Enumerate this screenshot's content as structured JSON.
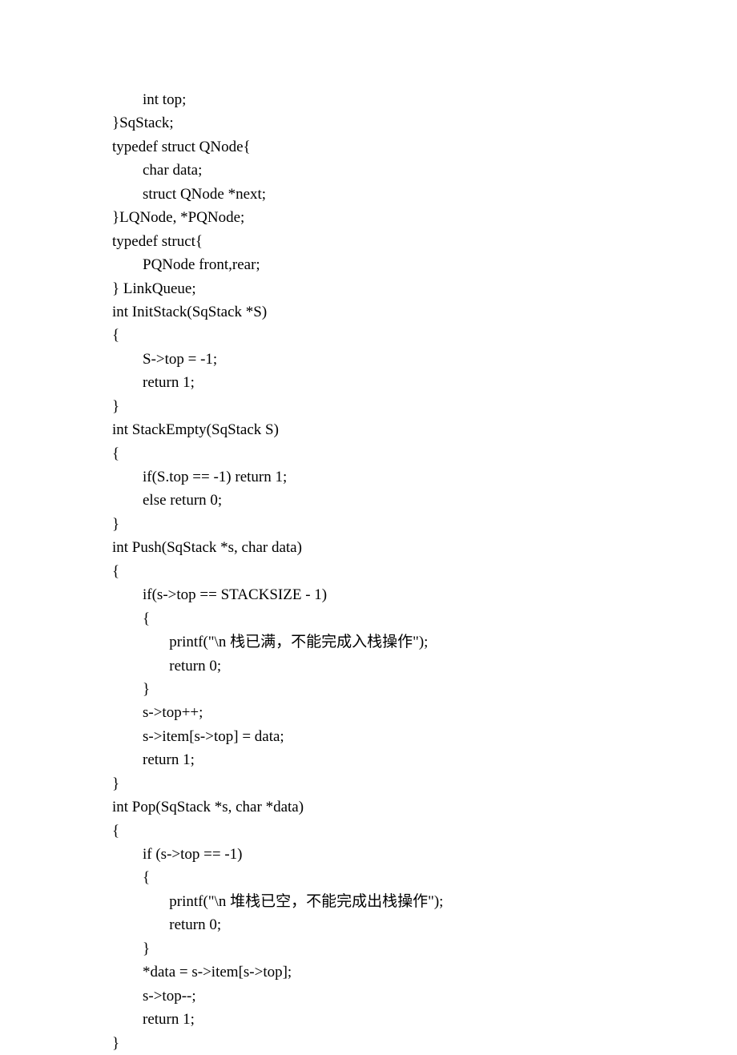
{
  "code_lines": [
    "        int top;",
    "}SqStack;",
    "",
    "typedef struct QNode{",
    "        char data;",
    "        struct QNode *next;",
    "}LQNode, *PQNode;",
    "",
    "typedef struct{",
    "        PQNode front,rear;",
    "} LinkQueue;",
    "",
    "int InitStack(SqStack *S)",
    "{",
    "        S->top = -1;",
    "        return 1;",
    "}",
    "int StackEmpty(SqStack S)",
    "{",
    "        if(S.top == -1) return 1;",
    "        else return 0;",
    "}",
    "int Push(SqStack *s, char data)",
    "{",
    "        if(s->top == STACKSIZE - 1)",
    "        {",
    "               printf(\"\\n 栈已满，不能完成入栈操作\");",
    "               return 0;",
    "        }",
    "        s->top++;",
    "        s->item[s->top] = data;",
    "        return 1;",
    "}",
    "int Pop(SqStack *s, char *data)",
    "{",
    "        if (s->top == -1)",
    "        {",
    "               printf(\"\\n 堆栈已空，不能完成出栈操作\");",
    "               return 0;",
    "        }",
    "        *data = s->item[s->top];",
    "        s->top--;",
    "        return 1;",
    "}"
  ]
}
